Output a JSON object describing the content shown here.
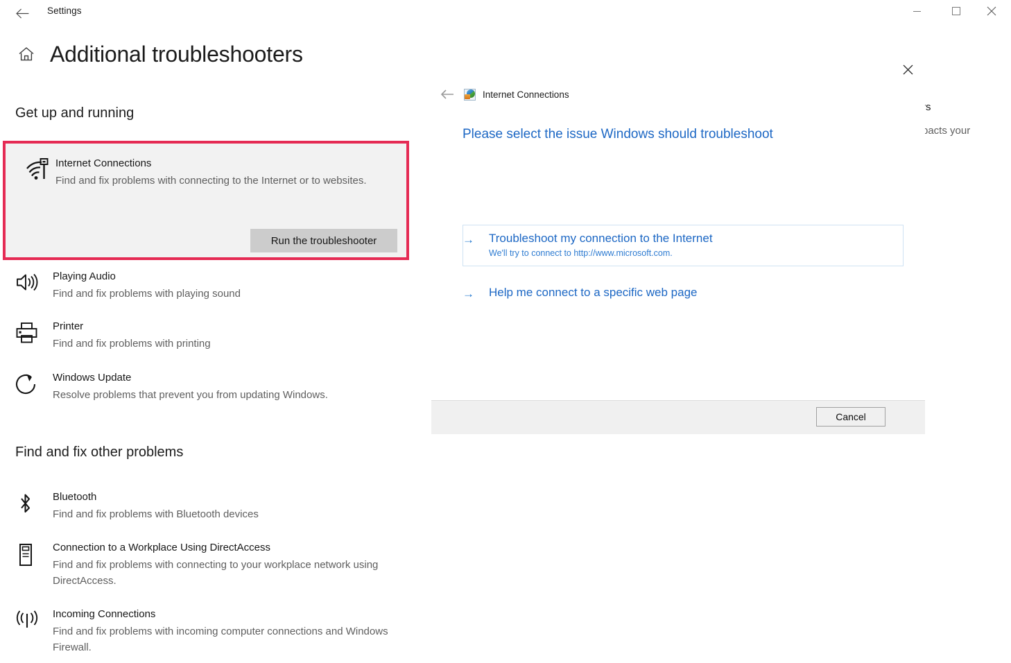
{
  "window": {
    "title": "Settings",
    "back_icon": "back-arrow-icon",
    "minimize_label": "Minimize",
    "maximize_label": "Maximize",
    "close_label": "Close"
  },
  "page": {
    "home_icon": "home-icon",
    "title": "Additional troubleshooters",
    "sections": [
      {
        "id": "get-up-and-running",
        "heading": "Get up and running"
      },
      {
        "id": "find-and-fix-other-problems",
        "heading": "Find and fix other problems"
      }
    ]
  },
  "highlighted_card": {
    "icon": "wifi-internet-icon",
    "title": "Internet Connections",
    "description": "Find and fix problems with connecting to the Internet or to websites.",
    "button_label": "Run the troubleshooter",
    "highlight_color": "#E52B54",
    "background_color": "#F2F2F2",
    "button_color": "#CCCCCC"
  },
  "troubleshooters": {
    "get_up_and_running": [
      {
        "icon": "speaker-audio-icon",
        "title": "Playing Audio",
        "description": "Find and fix problems with playing sound"
      },
      {
        "icon": "printer-icon",
        "title": "Printer",
        "description": "Find and fix problems with printing"
      },
      {
        "icon": "refresh-update-icon",
        "title": "Windows Update",
        "description": "Resolve problems that prevent you from updating Windows."
      }
    ],
    "find_and_fix_other_problems": [
      {
        "icon": "bluetooth-icon",
        "title": "Bluetooth",
        "description": "Find and fix problems with Bluetooth devices"
      },
      {
        "icon": "workplace-device-icon",
        "title": "Connection to a Workplace Using DirectAccess",
        "description": "Find and fix problems with connecting to your workplace network using DirectAccess."
      },
      {
        "icon": "incoming-signal-icon",
        "title": "Incoming Connections",
        "description": "Find and fix problems with incoming computer connections and Windows Firewall."
      }
    ]
  },
  "occluded_text": {
    "line1": "rs",
    "line2": "pacts your"
  },
  "dialog": {
    "close_icon": "close-icon",
    "back_icon": "back-arrow-icon",
    "app_icon": "internet-connections-icon",
    "app_title": "Internet Connections",
    "heading": "Please select the issue Windows should troubleshoot",
    "heading_color": "#1C67C4",
    "options": [
      {
        "arrow": "→",
        "label": "Troubleshoot my connection to the Internet",
        "sublabel": "We'll try to connect to http://www.microsoft.com.",
        "focused": true
      },
      {
        "arrow": "→",
        "label": "Help me connect to a specific web page",
        "sublabel": "",
        "focused": false
      }
    ],
    "cancel_label": "Cancel"
  }
}
